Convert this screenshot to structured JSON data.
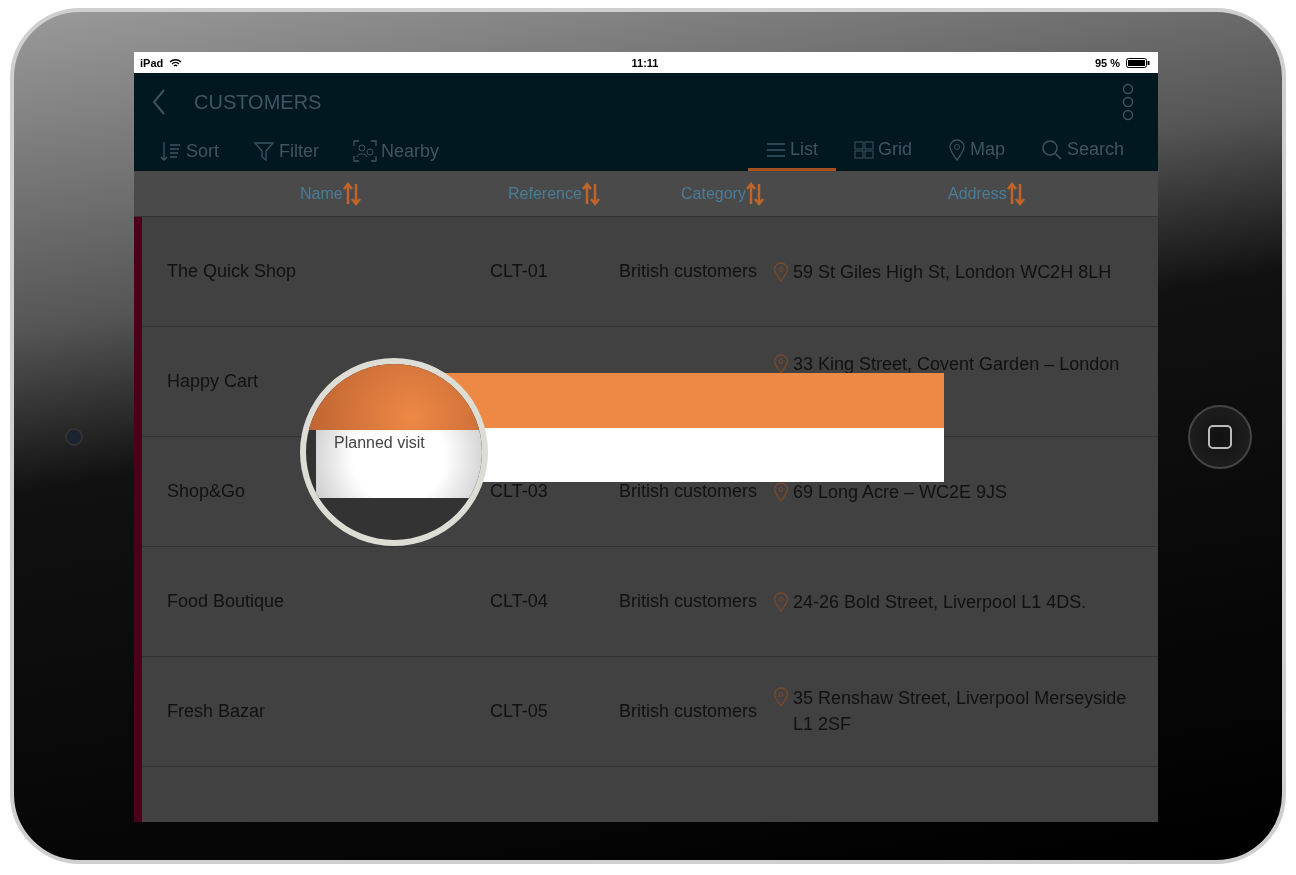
{
  "status_bar": {
    "device": "iPad",
    "time": "11:11",
    "battery": "95 %"
  },
  "header": {
    "title": "CUSTOMERS"
  },
  "actions": [
    {
      "label": "Sort",
      "kind": "sort"
    },
    {
      "label": "Filter",
      "kind": "filter"
    },
    {
      "label": "Nearby",
      "kind": "nearby"
    }
  ],
  "views": [
    {
      "label": "List",
      "kind": "list",
      "selected": true
    },
    {
      "label": "Grid",
      "kind": "grid",
      "selected": false
    },
    {
      "label": "Map",
      "kind": "map",
      "selected": false
    },
    {
      "label": "Search",
      "kind": "search",
      "selected": false
    }
  ],
  "columns": [
    "Name",
    "Reference",
    "Category",
    "Address"
  ],
  "rows": [
    {
      "name": "The Quick Shop",
      "reference": "CLT-01",
      "category": "British customers",
      "address": "59 St Giles High St, London WC2H 8LH"
    },
    {
      "name": "Happy Cart",
      "address": "33 King Street, Covent Garden – London"
    },
    {
      "name": "Shop&Go",
      "reference": "CLT-03",
      "category": "British customers",
      "address": "69 Long Acre – WC2E 9JS"
    },
    {
      "name": "Food Boutique",
      "reference": "CLT-04",
      "category": "British customers",
      "address": "24-26 Bold Street, Liverpool L1 4DS."
    },
    {
      "name": "Fresh Bazar",
      "reference": "CLT-05",
      "category": "British customers",
      "address": "35 Renshaw Street, Liverpool Merseyside L1 2SF"
    }
  ],
  "popup": {
    "option": "Planned visit"
  }
}
